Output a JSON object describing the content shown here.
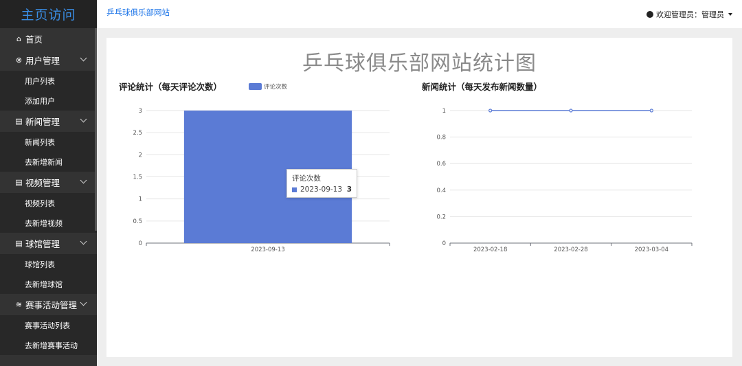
{
  "sidebar": {
    "logo": "主页访问",
    "items": [
      {
        "icon": "home-icon",
        "label": "首页",
        "children": []
      },
      {
        "icon": "user-icon",
        "label": "用户管理",
        "children": [
          "用户列表",
          "添加用户"
        ]
      },
      {
        "icon": "doc-icon",
        "label": "新闻管理",
        "children": [
          "新闻列表",
          "去新增新闻"
        ]
      },
      {
        "icon": "doc-icon",
        "label": "视频管理",
        "children": [
          "视频列表",
          "去新增视频"
        ]
      },
      {
        "icon": "doc-icon",
        "label": "球馆管理",
        "children": [
          "球馆列表",
          "去新增球馆"
        ]
      },
      {
        "icon": "layers-icon",
        "label": "赛事活动管理",
        "children": [
          "赛事活动列表",
          "去新增赛事活动"
        ]
      }
    ]
  },
  "header": {
    "site_name": "乒乓球俱乐部网站",
    "welcome": "欢迎管理员：管理员"
  },
  "main": {
    "title": "乒乓球俱乐部网站统计图"
  },
  "tooltip": {
    "title": "评论次数",
    "date": "2023-09-13",
    "value": "3"
  },
  "colors": {
    "accent": "#5b7bd5",
    "logo": "#3a8ee6",
    "sidebar_bg": "#333333"
  },
  "chart_data": [
    {
      "type": "bar",
      "title": "评论统计（每天评论次数）",
      "legend": [
        "评论次数"
      ],
      "legend_position": "top",
      "categories": [
        "2023-09-13"
      ],
      "series": [
        {
          "name": "评论次数",
          "values": [
            3
          ]
        }
      ],
      "y_ticks": [
        "0",
        "0.5",
        "1",
        "1.5",
        "2",
        "2.5",
        "3"
      ],
      "ylim": [
        0,
        3
      ],
      "grid": true
    },
    {
      "type": "line",
      "title": "新闻统计（每天发布新闻数量）",
      "categories": [
        "2023-02-18",
        "2023-02-28",
        "2023-03-04"
      ],
      "series": [
        {
          "values": [
            1,
            1,
            1
          ]
        }
      ],
      "y_ticks": [
        "0",
        "0.2",
        "0.4",
        "0.6",
        "0.8",
        "1"
      ],
      "ylim": [
        0,
        1
      ],
      "grid": true
    }
  ]
}
